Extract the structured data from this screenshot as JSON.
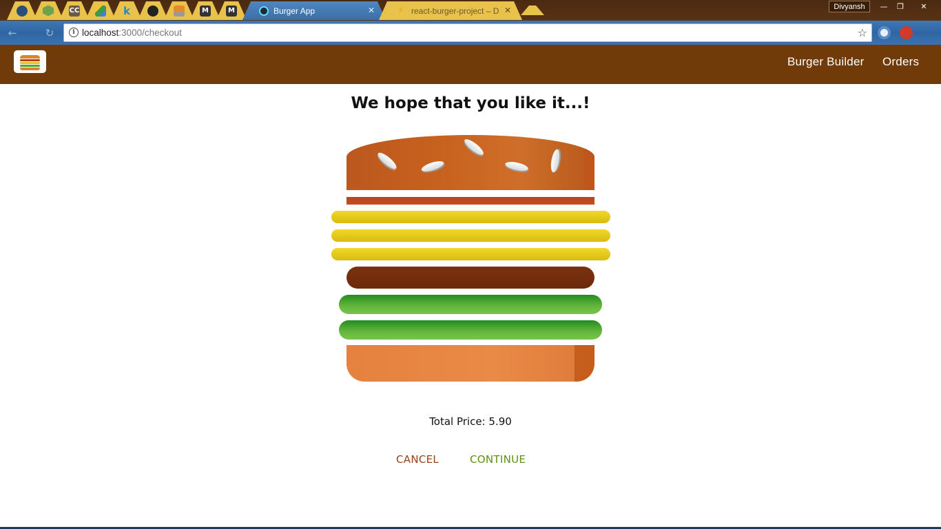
{
  "browser": {
    "tabs": [
      {
        "icon": "bird-icon",
        "color": "#2a4f7a"
      },
      {
        "icon": "nodejs-icon",
        "color": "#6fa24c"
      },
      {
        "icon": "cc-icon",
        "color": "#6b5a4a",
        "glyph": "CC"
      },
      {
        "icon": "drive-icon",
        "color": "#4a9a4a"
      },
      {
        "icon": "k-icon",
        "color": "#1f8fd0",
        "glyph": "k"
      },
      {
        "icon": "github-icon",
        "color": "#222222"
      },
      {
        "icon": "stackoverflow-icon",
        "color": "#e48a2a"
      },
      {
        "icon": "medium-icon",
        "color": "#333333",
        "glyph": "M"
      },
      {
        "icon": "medium-icon",
        "color": "#333333",
        "glyph": "M"
      }
    ],
    "active_tab": {
      "title": "Burger App",
      "icon": "react-icon"
    },
    "second_tab": {
      "title": "react-burger-project – D",
      "icon": "firebase-icon"
    },
    "profile_name": "Divyansh",
    "url_host": "localhost",
    "url_path": ":3000/checkout"
  },
  "nav": {
    "burger_builder": "Burger Builder",
    "orders": "Orders"
  },
  "checkout": {
    "heading": "We hope that you like it...!",
    "total_label": "Total Price: 5.90",
    "cancel_label": "CANCEL",
    "continue_label": "CONTINUE"
  },
  "burger": {
    "ingredients": [
      "bacon",
      "cheese",
      "cheese",
      "cheese",
      "meat",
      "salad",
      "salad"
    ]
  },
  "colors": {
    "header": "#703b09",
    "cancel": "#944317",
    "continue": "#5c9210",
    "cheese": "#e6c81c",
    "meat": "#742e0d",
    "salad": "#4fa62e"
  }
}
